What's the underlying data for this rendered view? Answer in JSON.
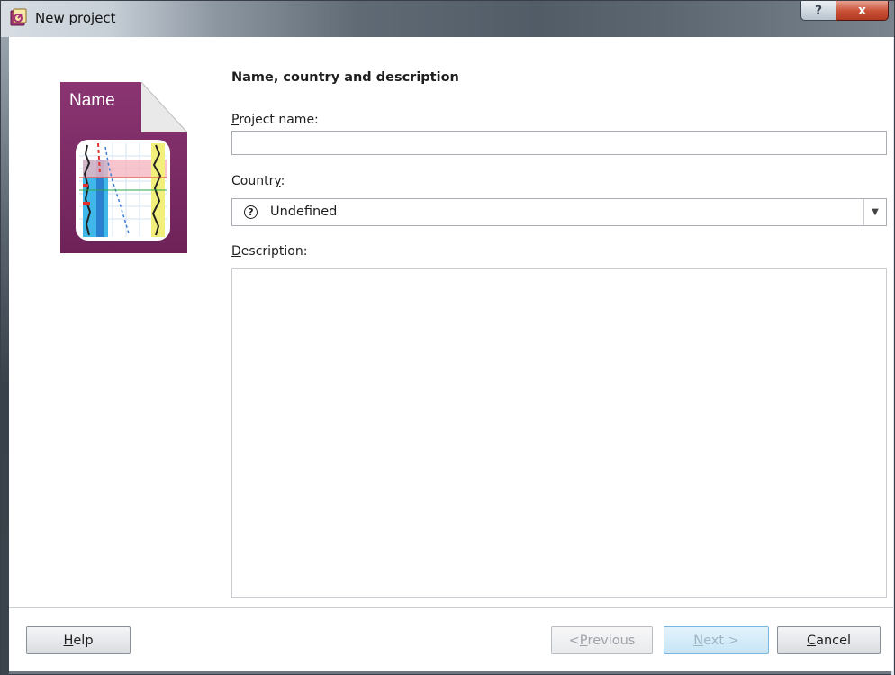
{
  "window": {
    "title": "New project",
    "help_glyph": "?",
    "close_glyph": "x"
  },
  "illustration": {
    "caption": "Name",
    "icon": "project-document-icon"
  },
  "section": {
    "heading": "Name, country and description"
  },
  "fields": {
    "project_name": {
      "label_accel": "P",
      "label_rest": "roject name:",
      "value": ""
    },
    "country": {
      "label_pre": "Countr",
      "label_accel": "y",
      "label_post": ":",
      "value": "Undefined",
      "icon_glyph": "?"
    },
    "description": {
      "label_accel": "D",
      "label_rest": "escription:",
      "value": ""
    }
  },
  "buttons": {
    "help": {
      "accel": "H",
      "rest": "elp",
      "enabled": true
    },
    "previous": {
      "pre": "< ",
      "accel": "P",
      "rest": "revious",
      "enabled": false
    },
    "next": {
      "accel": "N",
      "rest": "ext >",
      "enabled": false
    },
    "cancel": {
      "accel": "C",
      "rest": "ancel",
      "enabled": true
    }
  },
  "colors": {
    "accent": "#7b2a63",
    "next_button_border": "#79b6dd",
    "close_button": "#c94f35"
  }
}
